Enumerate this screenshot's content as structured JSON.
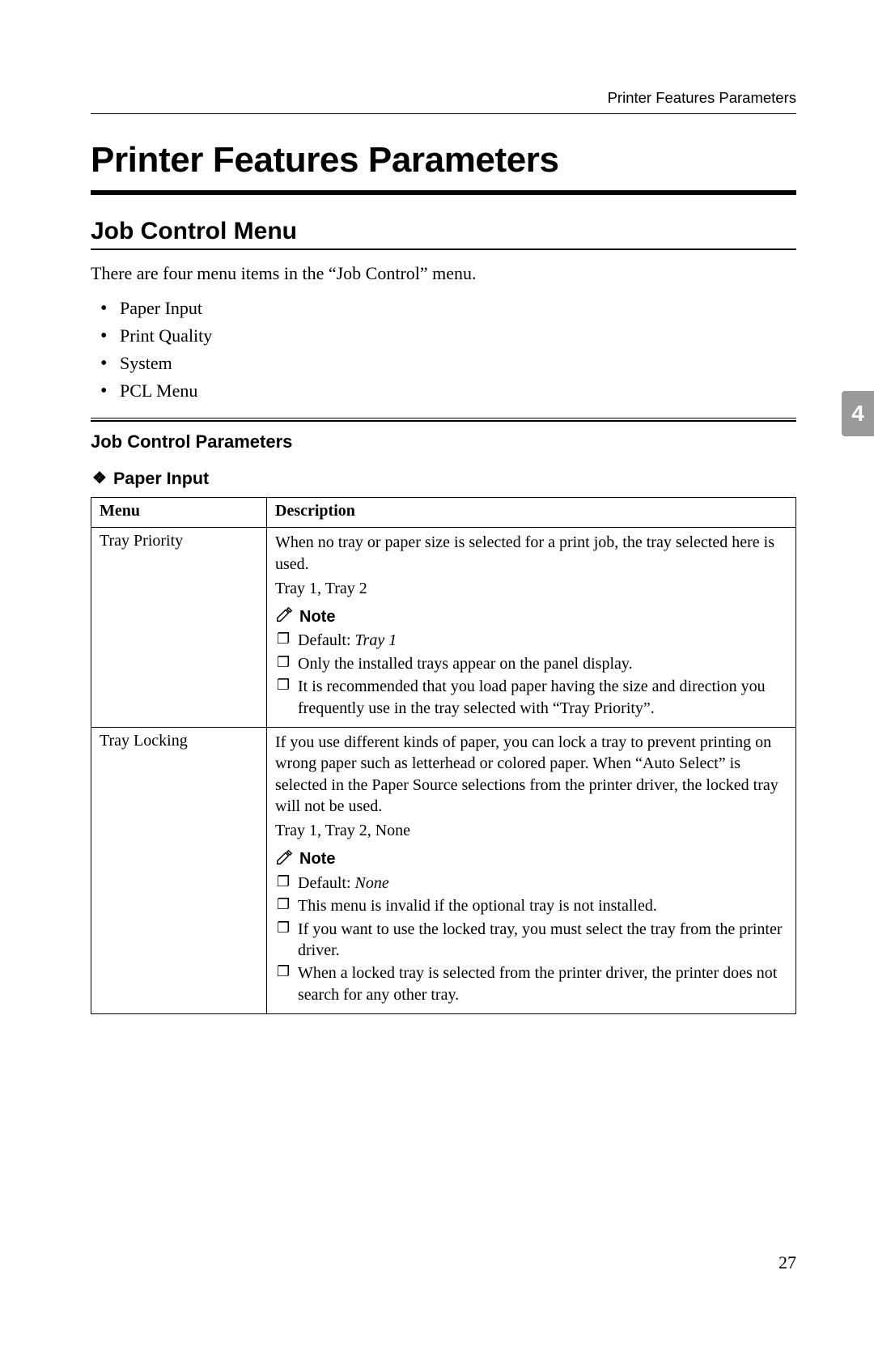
{
  "running_header": "Printer Features Parameters",
  "chapter_tab": "4",
  "page_number": "27",
  "h1": "Printer Features Parameters",
  "section": {
    "title": "Job Control Menu",
    "intro": "There are four menu items in the “Job Control” menu.",
    "items": [
      "Paper Input",
      "Print Quality",
      "System",
      "PCL Menu"
    ],
    "subsection_title": "Job Control Parameters",
    "group_title": "Paper Input",
    "table": {
      "headers": [
        "Menu",
        "Description"
      ],
      "rows": [
        {
          "menu": "Tray Priority",
          "desc": "When no tray or paper size is selected for a print job, the tray selected here is used.",
          "values": "Tray 1, Tray 2",
          "note_label": "Note",
          "notes": [
            {
              "prefix": "Default: ",
              "italic": "Tray 1",
              "suffix": ""
            },
            {
              "text": "Only the installed trays appear on the panel display."
            },
            {
              "text": "It is recommended that you load paper having the size and direction you frequently use in the tray selected with “Tray Priority”."
            }
          ]
        },
        {
          "menu": "Tray Locking",
          "desc": "If you use different kinds of paper, you can lock a tray to prevent printing on wrong paper such as letterhead or colored paper. When “Auto Select” is selected in the Paper Source selections from the printer driver, the locked tray will not be used.",
          "values": "Tray 1, Tray 2, None",
          "note_label": "Note",
          "notes": [
            {
              "prefix": "Default: ",
              "italic": "None",
              "suffix": ""
            },
            {
              "text": "This menu is invalid if the optional tray is not installed."
            },
            {
              "text": "If you want to use the locked tray, you must select the tray from the printer driver."
            },
            {
              "text": "When a locked tray is selected from the printer driver, the printer does not search for any other tray."
            }
          ]
        }
      ]
    }
  }
}
